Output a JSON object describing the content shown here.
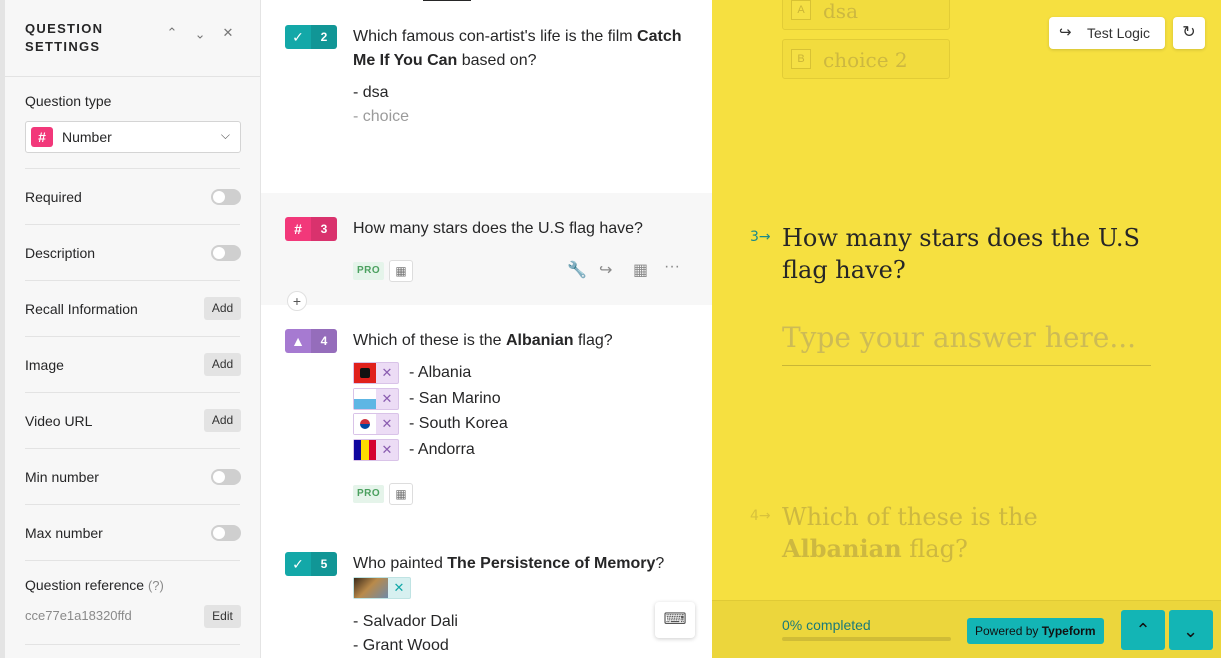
{
  "settings": {
    "heading": "QUESTION SETTINGS",
    "question_type_label": "Question type",
    "question_type_value": "Number",
    "rows": [
      {
        "label": "Required",
        "control": "toggle"
      },
      {
        "label": "Description",
        "control": "toggle"
      },
      {
        "label": "Recall Information",
        "control": "add",
        "button": "Add"
      },
      {
        "label": "Image",
        "control": "add",
        "button": "Add"
      },
      {
        "label": "Video URL",
        "control": "add",
        "button": "Add"
      },
      {
        "label": "Min number",
        "control": "toggle"
      },
      {
        "label": "Max number",
        "control": "toggle"
      }
    ],
    "reference_label": "Question reference",
    "reference_hint": "(?)",
    "reference_value": "cce77e1a18320ffd",
    "edit_label": "Edit"
  },
  "builder": {
    "q2": {
      "number": "2",
      "text_before": "Which famous con-artist's life is the film ",
      "text_bold": "Catch Me If You Can",
      "text_after": " based on?",
      "choices": [
        "- dsa"
      ],
      "choice_placeholder": "- choice"
    },
    "q3": {
      "number": "3",
      "text": "How many stars does the U.S flag have?",
      "pro": "PRO"
    },
    "q4": {
      "number": "4",
      "text_before": "Which of these is the ",
      "text_bold": "Albanian",
      "text_after": " flag?",
      "options": [
        "- Albania",
        "- San Marino",
        "- South Korea",
        "- Andorra"
      ],
      "pro": "PRO"
    },
    "q5": {
      "number": "5",
      "text_before": "Who painted ",
      "text_bold": "The Persistence of Memory",
      "text_after": "?",
      "choices": [
        "- Salvador Dali",
        "- Grant Wood"
      ]
    }
  },
  "preview": {
    "ghost_options": [
      {
        "key": "A",
        "text": "dsa"
      },
      {
        "key": "B",
        "text": "choice 2"
      }
    ],
    "test_logic": "Test Logic",
    "current_number": "3",
    "current_question": "How many stars does the U.S flag have?",
    "answer_placeholder": "Type your answer here...",
    "next_number": "4",
    "next_before": "Which of these is the ",
    "next_bold": "Albanian",
    "next_after": " flag?",
    "progress_text": "0% completed",
    "progress": 0,
    "powered_prefix": "Powered by ",
    "powered_brand": "Typeform"
  },
  "colors": {
    "number_badge": "#f2387a",
    "check_badge": "#13a8a8",
    "image_badge": "#a67ad1",
    "preview_bg": "#f6e040",
    "accent": "#13b5b5"
  }
}
